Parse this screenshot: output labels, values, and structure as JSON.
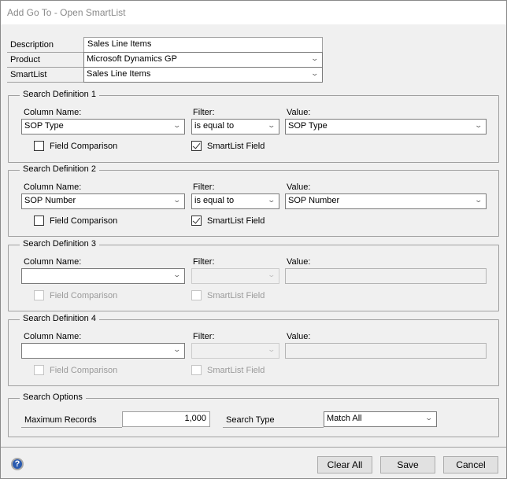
{
  "window": {
    "title": "Add Go To - Open SmartList"
  },
  "header": {
    "description": {
      "label": "Description",
      "value": "Sales Line Items"
    },
    "product": {
      "label": "Product",
      "value": "Microsoft Dynamics GP"
    },
    "smartlist": {
      "label": "SmartList",
      "value": "Sales Line Items"
    }
  },
  "search_definitions": [
    {
      "title": "Search Definition 1",
      "column_label": "Column Name:",
      "column_value": "SOP Type",
      "filter_label": "Filter:",
      "filter_value": "is equal to",
      "value_label": "Value:",
      "value_value": "SOP Type",
      "field_comparison_label": "Field Comparison",
      "field_comparison_checked": false,
      "smartlist_field_label": "SmartList Field",
      "smartlist_field_checked": true,
      "enabled": true
    },
    {
      "title": "Search Definition 2",
      "column_label": "Column Name:",
      "column_value": "SOP Number",
      "filter_label": "Filter:",
      "filter_value": "is equal to",
      "value_label": "Value:",
      "value_value": "SOP Number",
      "field_comparison_label": "Field Comparison",
      "field_comparison_checked": false,
      "smartlist_field_label": "SmartList Field",
      "smartlist_field_checked": true,
      "enabled": true
    },
    {
      "title": "Search Definition 3",
      "column_label": "Column Name:",
      "column_value": "",
      "filter_label": "Filter:",
      "filter_value": "",
      "value_label": "Value:",
      "value_value": "",
      "field_comparison_label": "Field Comparison",
      "field_comparison_checked": false,
      "smartlist_field_label": "SmartList Field",
      "smartlist_field_checked": false,
      "enabled": false
    },
    {
      "title": "Search Definition 4",
      "column_label": "Column Name:",
      "column_value": "",
      "filter_label": "Filter:",
      "filter_value": "",
      "value_label": "Value:",
      "value_value": "",
      "field_comparison_label": "Field Comparison",
      "field_comparison_checked": false,
      "smartlist_field_label": "SmartList Field",
      "smartlist_field_checked": false,
      "enabled": false
    }
  ],
  "search_options": {
    "title": "Search Options",
    "max_records_label": "Maximum Records",
    "max_records_value": "1,000",
    "search_type_label": "Search Type",
    "search_type_value": "Match All"
  },
  "footer": {
    "help_icon": "help-icon",
    "clear_all": "Clear All",
    "save": "Save",
    "cancel": "Cancel"
  }
}
